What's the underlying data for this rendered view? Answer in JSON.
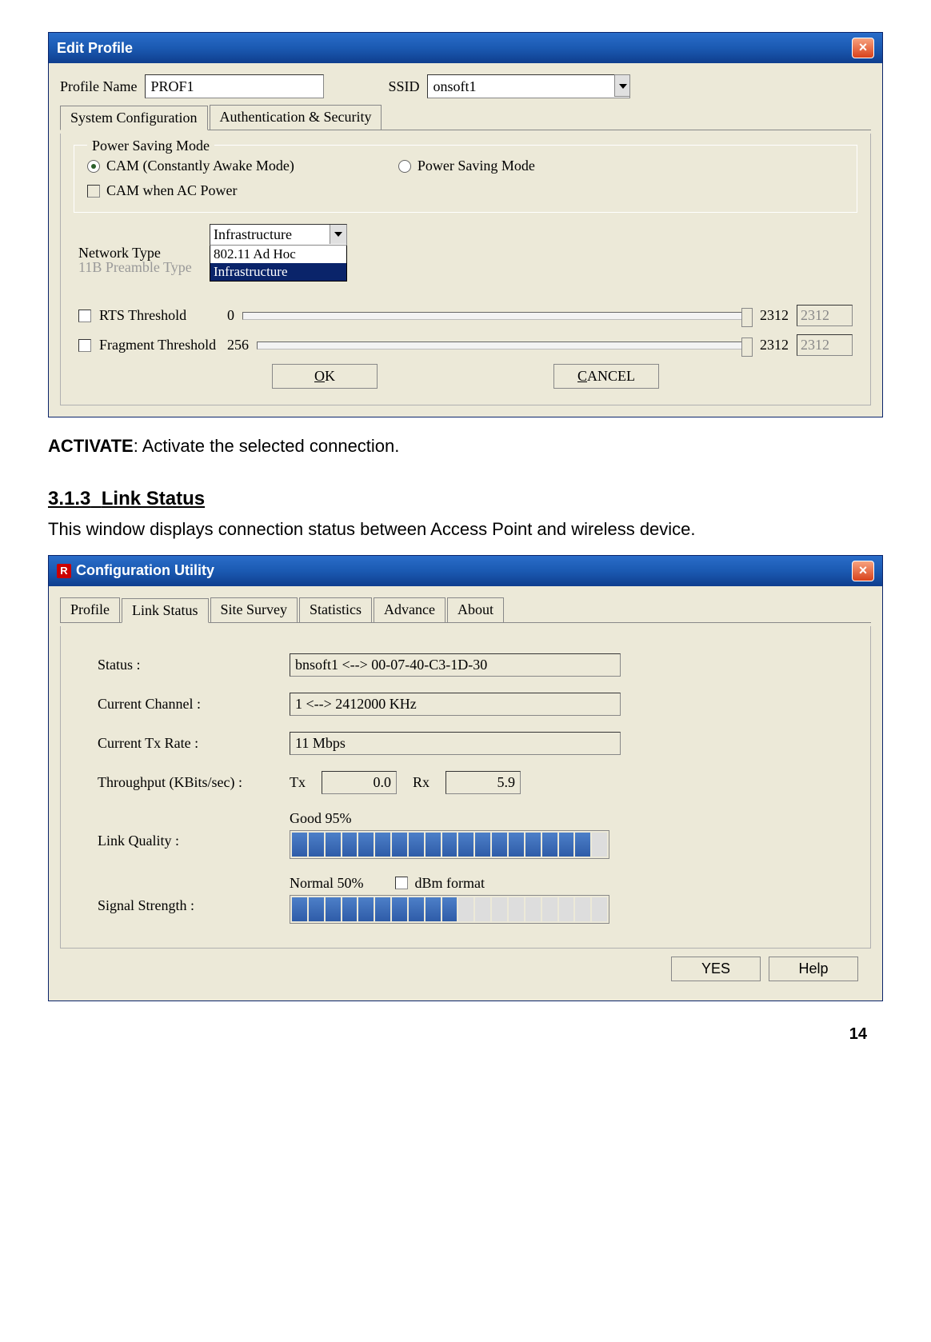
{
  "editProfile": {
    "title": "Edit Profile",
    "profileNameLabel": "Profile Name",
    "profileNameValue": "PROF1",
    "ssidLabel": "SSID",
    "ssidValue": "onsoft1",
    "tabs": {
      "sysConfig": "System Configuration",
      "authSec": "Authentication & Security"
    },
    "powerSaving": {
      "legend": "Power Saving Mode",
      "camLabel": "CAM (Constantly Awake Mode)",
      "psmLabel": "Power Saving Mode",
      "camWhenAC": "CAM when AC Power"
    },
    "networkTypeLabel": "Network Type",
    "networkTypeValue": "Infrastructure",
    "networkTypeOptions": {
      "adhoc": "802.11 Ad Hoc",
      "infra": "Infrastructure"
    },
    "preambleLabel": "11B Preamble Type",
    "rts": {
      "label": "RTS Threshold",
      "min": "0",
      "max": "2312",
      "value": "2312"
    },
    "frag": {
      "label": "Fragment Threshold",
      "min": "256",
      "max": "2312",
      "value": "2312"
    },
    "ok": "OK",
    "cancel": "CANCEL"
  },
  "docText": {
    "activateLabel": "ACTIVATE",
    "activateDesc": ": Activate the selected connection.",
    "sectionNum": "3.1.3",
    "sectionTitle": "Link Status",
    "sectionBody": "This window displays connection status between Access Point and wireless device."
  },
  "configUtility": {
    "title": "Configuration Utility",
    "tabs": {
      "profile": "Profile",
      "linkStatus": "Link Status",
      "siteSurvey": "Site Survey",
      "statistics": "Statistics",
      "advance": "Advance",
      "about": "About"
    },
    "statusLabel": "Status :",
    "statusValue": "bnsoft1 <--> 00-07-40-C3-1D-30",
    "channelLabel": "Current Channel :",
    "channelValue": "1 <--> 2412000 KHz",
    "txRateLabel": "Current Tx Rate :",
    "txRateValue": "11 Mbps",
    "throughputLabel": "Throughput (KBits/sec) :",
    "txLabel": "Tx",
    "txValue": "0.0",
    "rxLabel": "Rx",
    "rxValue": "5.9",
    "linkQualityLabel": "Link Quality :",
    "linkQualityText": "Good 95%",
    "signalLabel": "Signal Strength :",
    "signalText": "Normal 50%",
    "dbmLabel": "dBm format",
    "yesBtn": "YES",
    "helpBtn": "Help"
  },
  "chart_data": [
    {
      "type": "bar",
      "title": "Link Quality",
      "values": [
        95
      ],
      "ylim": [
        0,
        100
      ],
      "segments_on": 18,
      "segments_total": 19,
      "label": "Good 95%"
    },
    {
      "type": "bar",
      "title": "Signal Strength",
      "values": [
        50
      ],
      "ylim": [
        0,
        100
      ],
      "segments_on": 10,
      "segments_total": 19,
      "label": "Normal 50%"
    }
  ],
  "pageNumber": "14"
}
